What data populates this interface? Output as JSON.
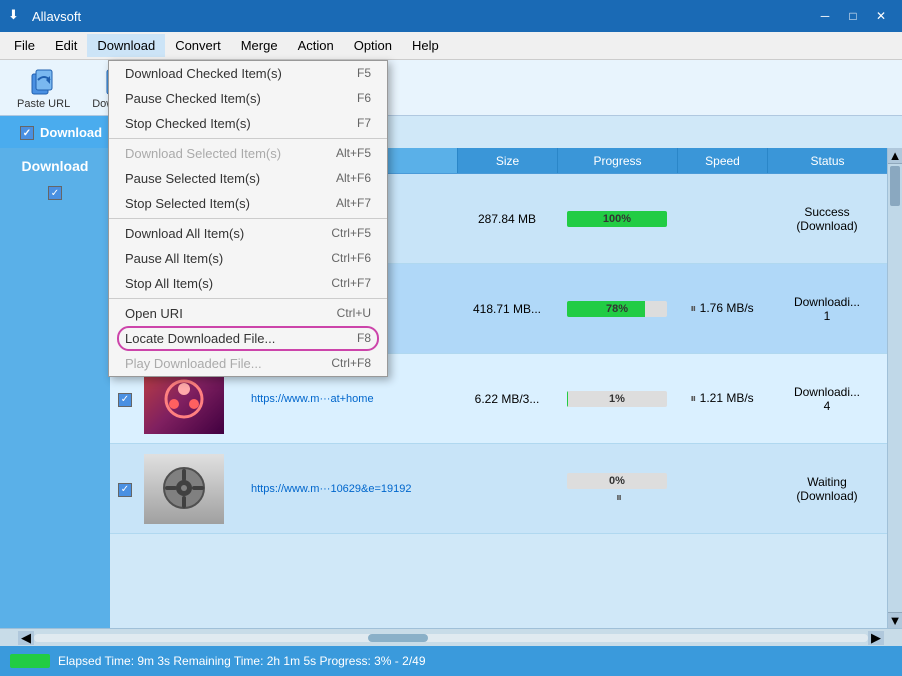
{
  "app": {
    "title": "Allavsoft",
    "icon": "⬇"
  },
  "titlebar": {
    "minimize": "─",
    "maximize": "□",
    "close": "✕"
  },
  "menubar": {
    "items": [
      {
        "id": "file",
        "label": "File"
      },
      {
        "id": "edit",
        "label": "Edit"
      },
      {
        "id": "download",
        "label": "Download",
        "active": true
      },
      {
        "id": "convert",
        "label": "Convert"
      },
      {
        "id": "merge",
        "label": "Merge"
      },
      {
        "id": "action",
        "label": "Action"
      },
      {
        "id": "option",
        "label": "Option"
      },
      {
        "id": "help",
        "label": "Help"
      }
    ]
  },
  "toolbar": {
    "buttons": [
      {
        "id": "paste-url",
        "label": "Paste URL",
        "icon": "paste"
      },
      {
        "id": "download-btn",
        "label": "Download",
        "icon": "download"
      }
    ]
  },
  "tabs": [
    {
      "id": "download-tab",
      "label": "Download",
      "active": true
    }
  ],
  "table": {
    "headers": [
      "",
      "",
      "",
      "Size",
      "Progress",
      "Speed",
      "Status"
    ],
    "rows": [
      {
        "id": "row-1",
        "checked": true,
        "url": "",
        "size": "287.84 MB",
        "progress": 100,
        "progress_label": "100%",
        "speed": "",
        "status": "Success\n(Download)",
        "status_line1": "Success",
        "status_line2": "(Download)"
      },
      {
        "id": "row-2",
        "checked": true,
        "url": "",
        "size": "418.71 MB...",
        "progress": 78,
        "progress_label": "78%",
        "speed": "1.76 MB/s",
        "status": "Downloadi...",
        "status_line1": "Downloadi...",
        "status_line2": "1"
      },
      {
        "id": "row-3",
        "checked": true,
        "url": "https://www.m···at+home",
        "size": "6.22 MB/3...",
        "progress": 1,
        "progress_label": "1%",
        "speed": "1.21 MB/s",
        "status": "Downloadi...",
        "status_line1": "Downloadi...",
        "status_line2": "4"
      },
      {
        "id": "row-4",
        "checked": true,
        "url": "https://www.m···10629&e=19192",
        "size": "",
        "progress": 0,
        "progress_label": "0%",
        "speed": "",
        "status": "Waiting\n(Download)",
        "status_line1": "Waiting",
        "status_line2": "(Download)"
      }
    ]
  },
  "dropdown": {
    "items": [
      {
        "id": "download-checked",
        "label": "Download Checked Item(s)",
        "shortcut": "F5",
        "disabled": false
      },
      {
        "id": "pause-checked",
        "label": "Pause Checked Item(s)",
        "shortcut": "F6",
        "disabled": false
      },
      {
        "id": "stop-checked",
        "label": "Stop Checked Item(s)",
        "shortcut": "F7",
        "disabled": false
      },
      {
        "separator": true
      },
      {
        "id": "download-selected",
        "label": "Download Selected Item(s)",
        "shortcut": "Alt+F5",
        "disabled": true
      },
      {
        "id": "pause-selected",
        "label": "Pause Selected Item(s)",
        "shortcut": "Alt+F6",
        "disabled": false
      },
      {
        "id": "stop-selected",
        "label": "Stop Selected Item(s)",
        "shortcut": "Alt+F7",
        "disabled": false
      },
      {
        "separator": true
      },
      {
        "id": "download-all",
        "label": "Download All Item(s)",
        "shortcut": "Ctrl+F5",
        "disabled": false
      },
      {
        "id": "pause-all",
        "label": "Pause All Item(s)",
        "shortcut": "Ctrl+F6",
        "disabled": false
      },
      {
        "id": "stop-all",
        "label": "Stop All Item(s)",
        "shortcut": "Ctrl+F7",
        "disabled": false
      },
      {
        "separator": true
      },
      {
        "id": "open-url",
        "label": "Open URI",
        "shortcut": "Ctrl+U",
        "disabled": false
      },
      {
        "id": "locate-file",
        "label": "Locate Downloaded File...",
        "shortcut": "F8",
        "disabled": false,
        "highlighted": true
      },
      {
        "id": "play-file",
        "label": "Play Downloaded File...",
        "shortcut": "Ctrl+F8",
        "disabled": true
      }
    ]
  },
  "statusbar": {
    "text": "Elapsed Time: 9m  3s Remaining Time: 2h  1m  5s Progress: 3% - 2/49"
  }
}
